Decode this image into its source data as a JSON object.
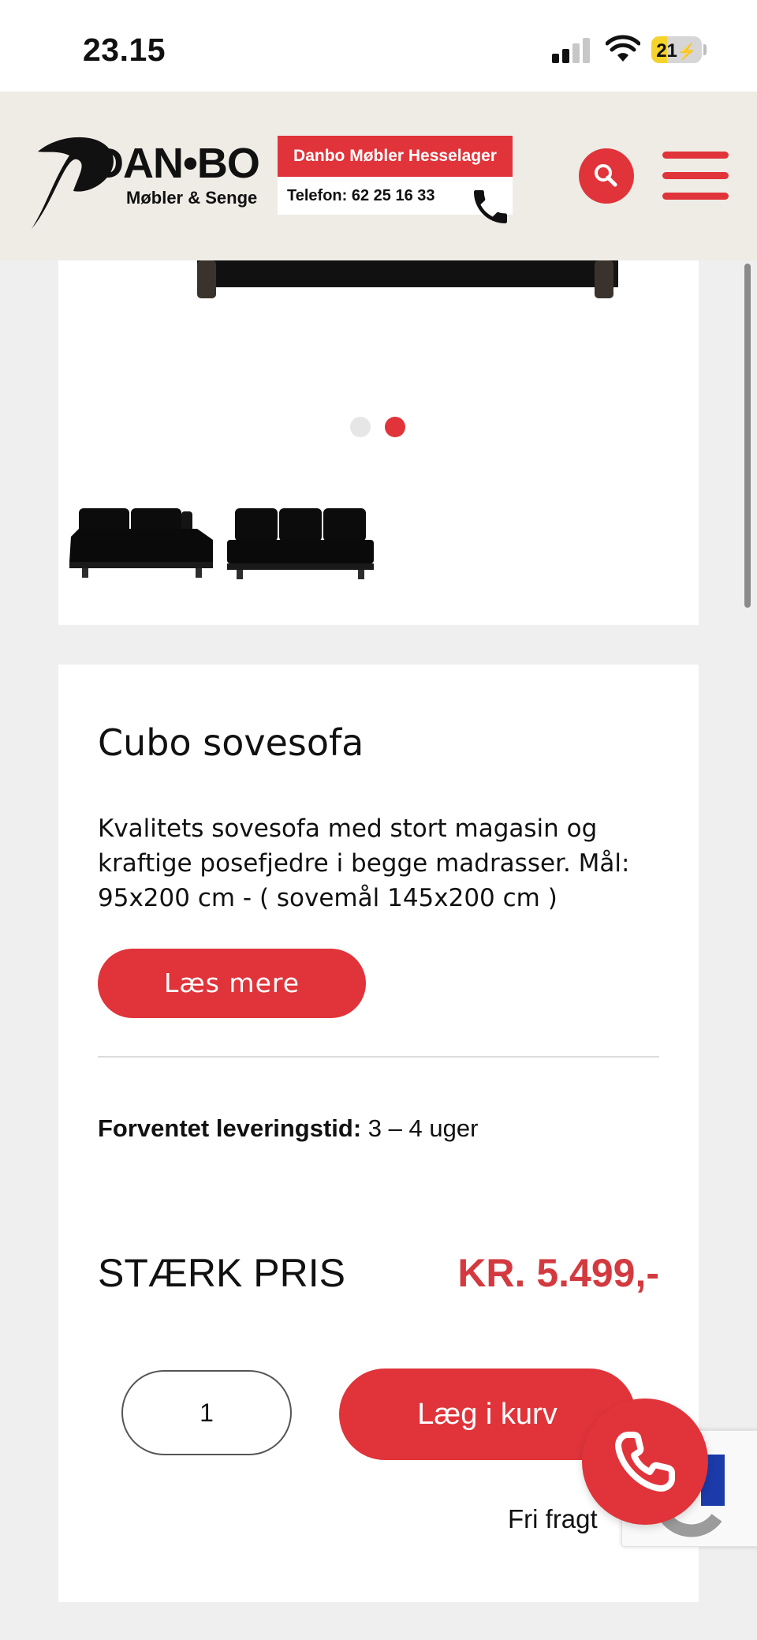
{
  "status_bar": {
    "time": "23.15",
    "battery": "21"
  },
  "header": {
    "logo_word": "DAN•BO",
    "logo_sub": "Møbler & Senge",
    "store_name": "Danbo Møbler Hesselager",
    "store_phone": "Telefon: 62 25 16 33"
  },
  "gallery": {
    "slide_count": 2,
    "active_slide": 2
  },
  "product": {
    "title": "Cubo sovesofa",
    "description": "Kvalitets sovesofa med stort magasin og kraftige posefjedre i begge madrasser. Mål: 95x200 cm - ( sovemål 145x200 cm )",
    "read_more_label": "Læs mere",
    "delivery_label": "Forventet leveringstid:",
    "delivery_value": " 3 – 4 uger",
    "price_label": "STÆRK PRIS",
    "price_value": "KR. 5.499,-",
    "quantity": "1",
    "add_to_cart_label": "Læg i kurv",
    "free_freight": "Fri fragt"
  },
  "colors": {
    "accent": "#e0343a",
    "price": "#d33a3f",
    "header_bg": "#efece6",
    "page_bg": "#efefef"
  }
}
